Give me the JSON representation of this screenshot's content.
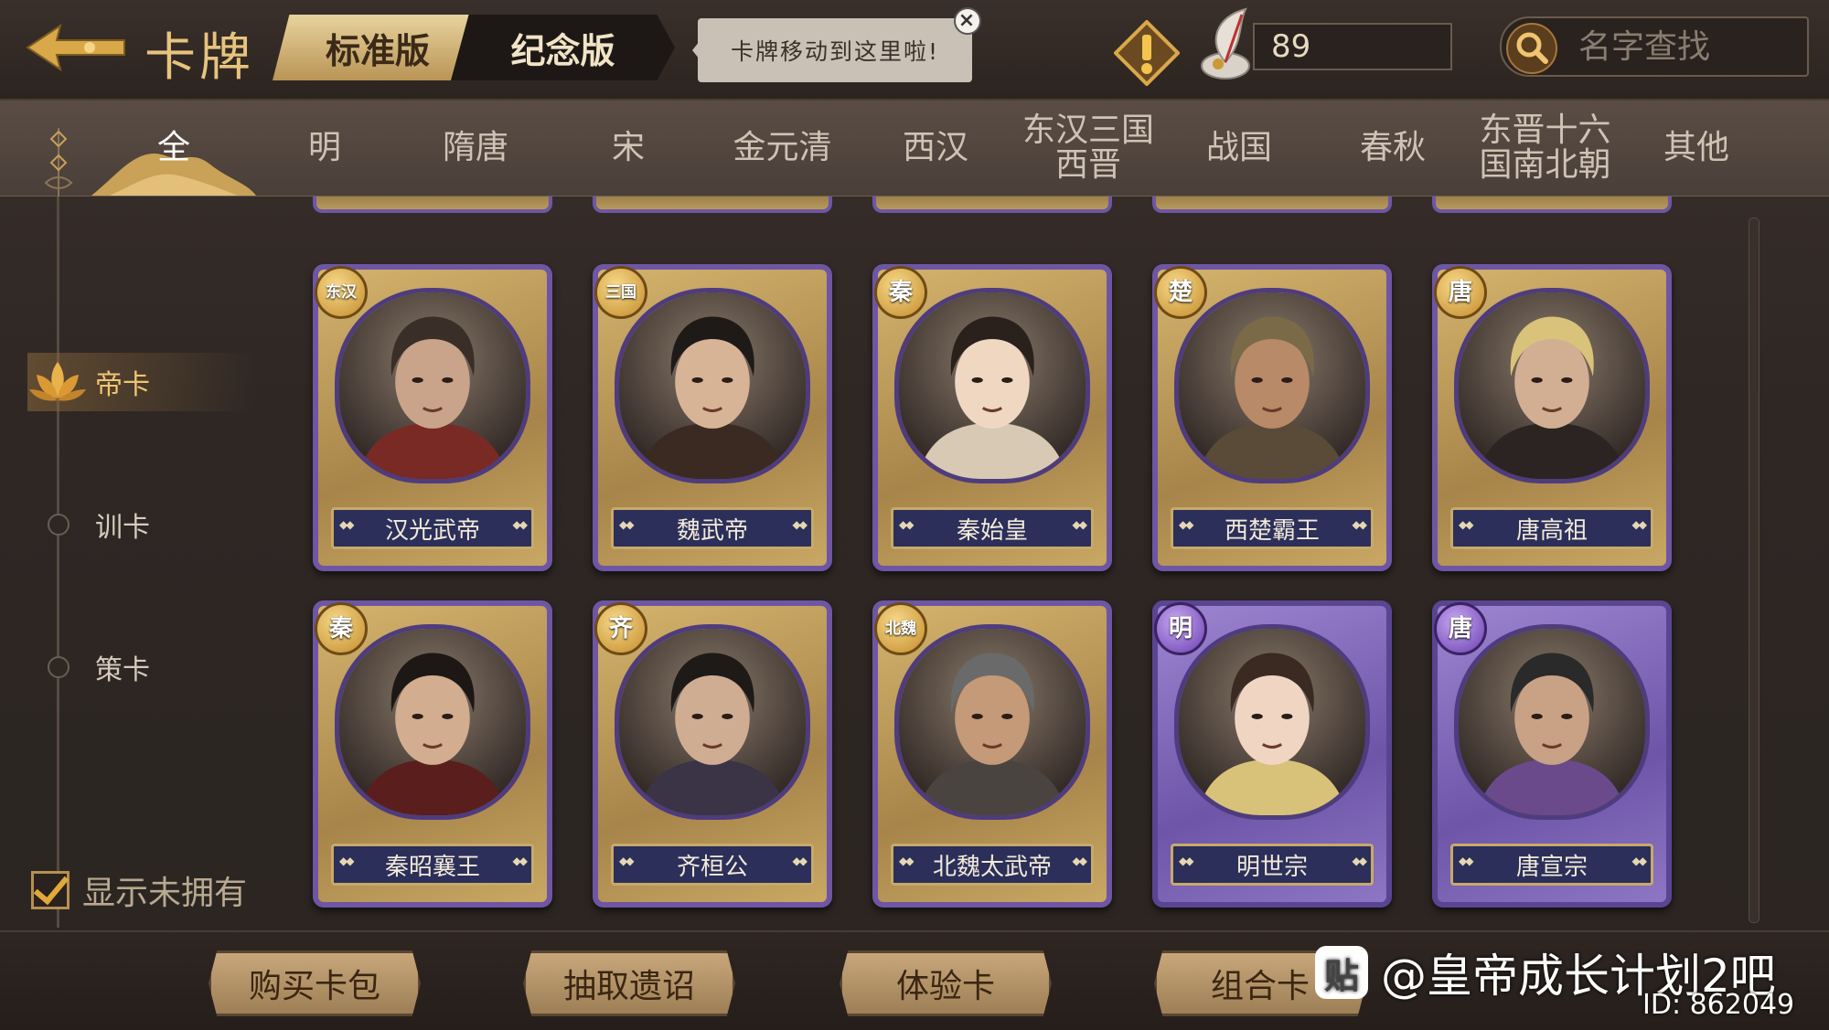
{
  "header": {
    "title": "卡牌",
    "tabs": [
      {
        "label": "标准版",
        "active": true
      },
      {
        "label": "纪念版",
        "active": false
      }
    ],
    "tooltip": "卡牌移动到这里啦!",
    "tooltip_close": "×",
    "currency_value": "89",
    "search_placeholder": "名字查找"
  },
  "eras": [
    {
      "label": "全",
      "active": true
    },
    {
      "label": "明"
    },
    {
      "label": "隋唐"
    },
    {
      "label": "宋"
    },
    {
      "label": "金元清"
    },
    {
      "label": "西汉"
    },
    {
      "label": "东汉三国\n西晋"
    },
    {
      "label": "战国"
    },
    {
      "label": "春秋"
    },
    {
      "label": "东晋十六\n国南北朝"
    },
    {
      "label": "其他"
    }
  ],
  "sidebar": {
    "items": [
      {
        "label": "帝卡",
        "active": true
      },
      {
        "label": "训卡"
      },
      {
        "label": "策卡"
      }
    ]
  },
  "cards": [
    {
      "badge": "东汉",
      "name": "汉光武帝",
      "rarity": "gold",
      "skin": "#c9a48a",
      "hair": "#3a2e28",
      "robe": "#7a2a24"
    },
    {
      "badge": "三国",
      "name": "魏武帝",
      "rarity": "gold",
      "skin": "#d8b497",
      "hair": "#1e1a18",
      "robe": "#3a2a22"
    },
    {
      "badge": "秦",
      "name": "秦始皇",
      "rarity": "gold",
      "skin": "#efd7c2",
      "hair": "#2a201c",
      "robe": "#d8c9b4"
    },
    {
      "badge": "楚",
      "name": "西楚霸王",
      "rarity": "gold",
      "skin": "#b88a68",
      "hair": "#7a6a48",
      "robe": "#5a4a38"
    },
    {
      "badge": "唐",
      "name": "唐高祖",
      "rarity": "gold",
      "skin": "#d2ae92",
      "hair": "#d9c27a",
      "robe": "#2c2422"
    },
    {
      "badge": "秦",
      "name": "秦昭襄王",
      "rarity": "gold",
      "skin": "#d2ad90",
      "hair": "#1d1816",
      "robe": "#5a1e1c"
    },
    {
      "badge": "齐",
      "name": "齐桓公",
      "rarity": "gold",
      "skin": "#cfad92",
      "hair": "#1e1a18",
      "robe": "#3a3446"
    },
    {
      "badge": "北魏",
      "name": "北魏太武帝",
      "rarity": "gold",
      "skin": "#c49a78",
      "hair": "#6a6a6a",
      "robe": "#4a4440"
    },
    {
      "badge": "明",
      "name": "明世宗",
      "rarity": "purple",
      "skin": "#efd5c2",
      "hair": "#3a2a22",
      "robe": "#d8c27a"
    },
    {
      "badge": "唐",
      "name": "唐宣宗",
      "rarity": "purple",
      "skin": "#c9a286",
      "hair": "#2a2a2a",
      "robe": "#6a4a8a"
    }
  ],
  "show_unowned": {
    "label": "显示未拥有",
    "checked": true
  },
  "bottom_buttons": [
    "购买卡包",
    "抽取遗诏",
    "体验卡",
    "组合卡"
  ],
  "watermark": {
    "icon": "贴",
    "text": "@皇帝成长计划2吧",
    "id": "ID: 862049"
  }
}
